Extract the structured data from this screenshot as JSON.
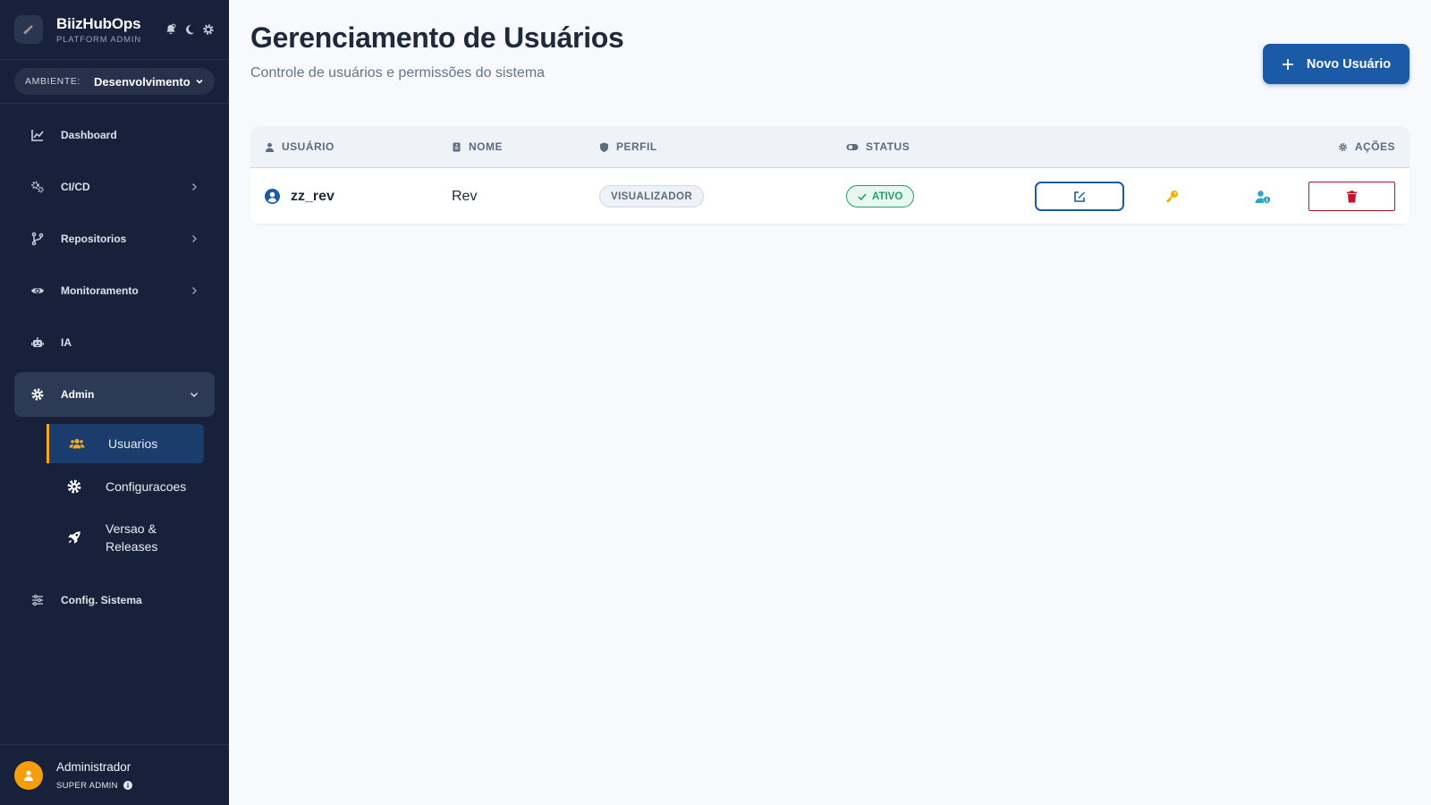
{
  "brand": {
    "name": "BiizHubOps",
    "subtitle": "PLATFORM ADMIN"
  },
  "environment": {
    "label": "AMBIENTE:",
    "value": "Desenvolvimento"
  },
  "nav": {
    "dashboard": "Dashboard",
    "cicd": "CI/CD",
    "repositorios": "Repositorios",
    "monitoramento": "Monitoramento",
    "ia": "IA",
    "admin": "Admin",
    "admin_sub": {
      "usuarios": "Usuarios",
      "configuracoes": "Configuracoes",
      "versao_line1": "Versao &",
      "versao_line2": "Releases"
    },
    "config_sistema": "Config. Sistema"
  },
  "user": {
    "name": "Administrador",
    "role": "SUPER ADMIN"
  },
  "page": {
    "title": "Gerenciamento de Usuários",
    "subtitle": "Controle de usuários e permissões do sistema",
    "new_button": "Novo Usuário"
  },
  "table": {
    "headers": {
      "usuario": "USUÁRIO",
      "nome": "NOME",
      "perfil": "PERFIL",
      "status": "STATUS",
      "acoes": "AÇÕES"
    },
    "rows": [
      {
        "username": "zz_rev",
        "nome": "Rev",
        "perfil": "VISUALIZADOR",
        "status": "ATIVO"
      }
    ]
  },
  "colors": {
    "sidebar_bg": "#17223a",
    "primary": "#1b5aa6",
    "accent": "#f6a623",
    "success": "#22a06b",
    "danger": "#c8102e"
  }
}
